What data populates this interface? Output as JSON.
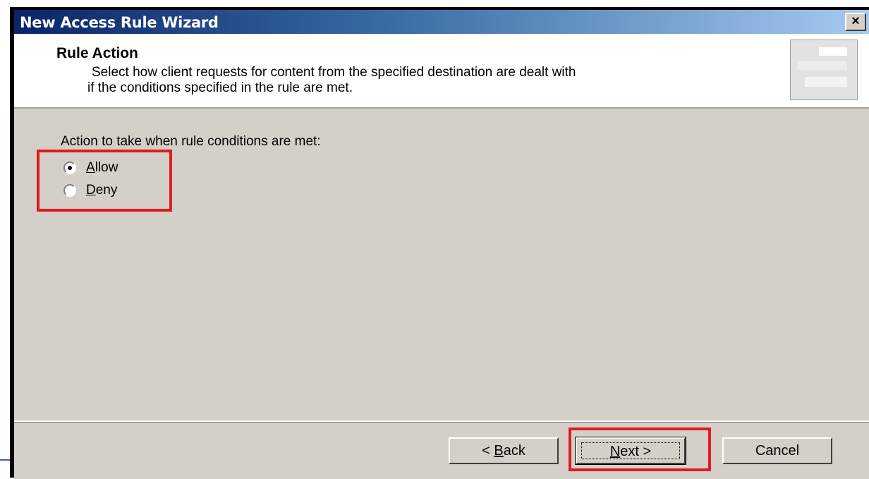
{
  "window": {
    "title": "New Access Rule Wizard",
    "close_label": "×"
  },
  "header": {
    "title": "Rule Action",
    "description_line1": "Select how client requests for content from the specified destination are dealt with",
    "description_line2": "if the conditions specified in the rule are met."
  },
  "body": {
    "action_label": "Action to take when rule conditions are met:",
    "options": [
      {
        "accel": "A",
        "rest": "llow",
        "checked": true
      },
      {
        "accel": "D",
        "rest": "eny",
        "checked": false
      }
    ]
  },
  "footer": {
    "back": {
      "prefix": "< ",
      "accel": "B",
      "rest": "ack"
    },
    "next": {
      "prefix": "",
      "accel": "N",
      "rest": "ext >"
    },
    "cancel": "Cancel"
  },
  "colors": {
    "highlight": "#e01a22",
    "titlebar": "#0a246a",
    "dialog_bg": "#d4d0c8"
  }
}
